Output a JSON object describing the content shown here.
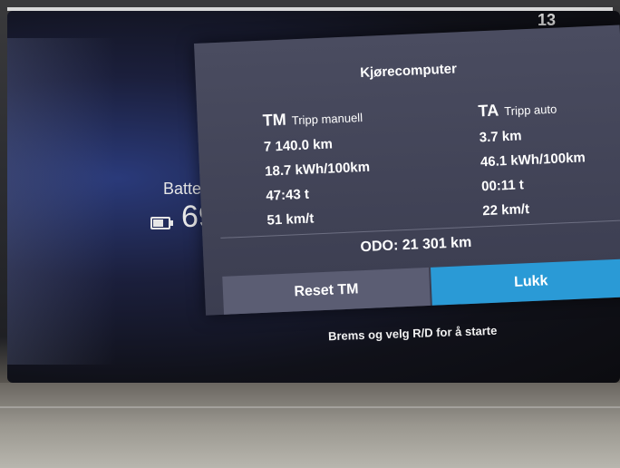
{
  "background": {
    "top_glyph": "13",
    "battery": {
      "label": "Batter",
      "value": "69"
    }
  },
  "dialog": {
    "title": "Kjørecomputer",
    "tm": {
      "head": "TM",
      "sub": "Tripp manuell",
      "rows": [
        "7 140.0 km",
        "18.7 kWh/100km",
        "47:43 t",
        "51 km/t"
      ]
    },
    "ta": {
      "head": "TA",
      "sub": "Tripp auto",
      "rows": [
        "3.7 km",
        "46.1 kWh/100km",
        "00:11 t",
        "22 km/t"
      ]
    },
    "odo": "ODO:  21 301 km",
    "buttons": {
      "reset": "Reset TM",
      "close": "Lukk"
    }
  },
  "hint": "Brems og velg R/D for å starte",
  "colors": {
    "dialog_bg": "#43455a",
    "close_button": "#2a9ad6",
    "reset_button": "#5b5d73"
  }
}
